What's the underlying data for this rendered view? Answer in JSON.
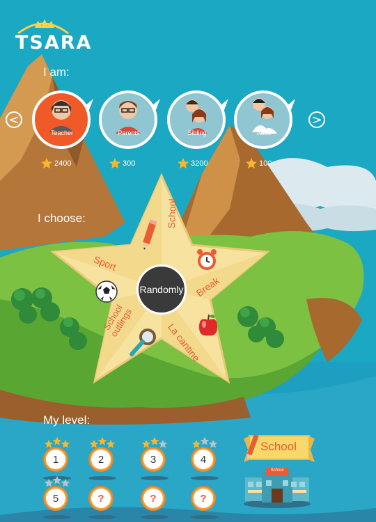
{
  "app": {
    "logo_text": "TSARA"
  },
  "section_i_am": "I am:",
  "section_i_choose": "I choose:",
  "section_level": "My level:",
  "nav": {
    "prev": "<",
    "next": ">"
  },
  "profiles": [
    {
      "label": "Teacher",
      "score": "2400",
      "selected": true
    },
    {
      "label": "Parents",
      "score": "300",
      "selected": false
    },
    {
      "label": "Sibling",
      "score": "3200",
      "selected": false
    },
    {
      "label": "Adult",
      "score": "100",
      "selected": false
    }
  ],
  "themes": {
    "school": "School",
    "sport": "Sport",
    "break": "Break",
    "school_outlings_line1": "School",
    "school_outlings_line2": "outlings",
    "la_cantine": "La cantine",
    "center": "Randomly"
  },
  "levels": [
    {
      "label": "1",
      "stars_filled": 3
    },
    {
      "label": "2",
      "stars_filled": 3
    },
    {
      "label": "3",
      "stars_filled": 2
    },
    {
      "label": "4",
      "stars_filled": 1
    },
    {
      "label": "5",
      "stars_filled": 0
    },
    {
      "label": "?",
      "stars_filled": 0
    },
    {
      "label": "?",
      "stars_filled": 0
    },
    {
      "label": "?",
      "stars_filled": 0
    }
  ],
  "current_theme_badge": "School",
  "building_sign": "School",
  "colors": {
    "sky": "#1aa8c2",
    "selected": "#f05a28",
    "bubble": "#8fc6d2",
    "accent": "#e85d34",
    "star": "#f7e2a0"
  }
}
